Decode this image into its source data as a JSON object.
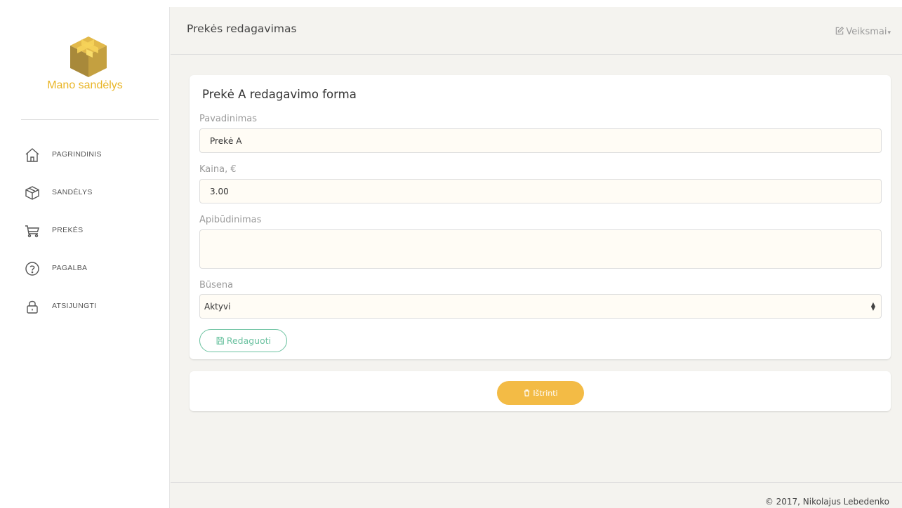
{
  "sidebar": {
    "brand": "Mano sandėlys",
    "items": [
      {
        "label": "PAGRINDINIS",
        "icon": "home-icon"
      },
      {
        "label": "SANDĖLYS",
        "icon": "box-icon"
      },
      {
        "label": "PREKĖS",
        "icon": "cart-icon"
      },
      {
        "label": "PAGALBA",
        "icon": "help-icon"
      },
      {
        "label": "ATSIJUNGTI",
        "icon": "lock-icon"
      }
    ]
  },
  "header": {
    "title": "Prekės redagavimas",
    "actions_label": "Veiksmai",
    "actions_icon": "edit-icon"
  },
  "form": {
    "title": "Prekė A redagavimo forma",
    "name_label": "Pavadinimas",
    "name_value": "Prekė A",
    "price_label": "Kaina, €",
    "price_value": "3.00",
    "description_label": "Apibūdinimas",
    "description_value": "",
    "status_label": "Būsena",
    "status_value": "Aktyvi",
    "submit_label": "Redaguoti",
    "submit_icon": "save-icon"
  },
  "delete": {
    "label": "Ištrinti",
    "icon": "trash-icon"
  },
  "footer": {
    "copyright": "© 2017, Nikolajus Lebedenko"
  },
  "colors": {
    "brand": "#e9b526",
    "success": "#6bc2a0",
    "warning": "#f3bb45",
    "background": "#f4f3ef",
    "input_bg": "#fffcf5"
  }
}
